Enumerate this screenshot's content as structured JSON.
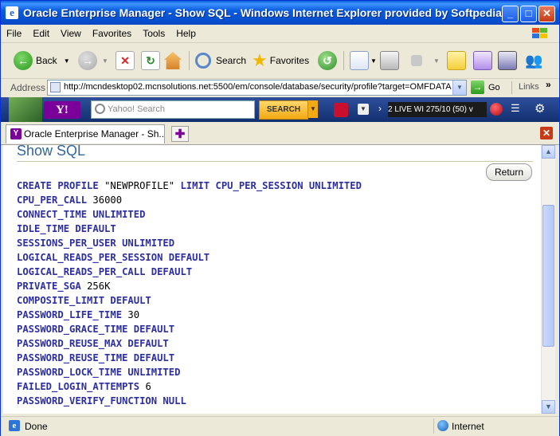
{
  "window": {
    "title": "Oracle Enterprise Manager - Show SQL - Windows Internet Explorer provided by Softpedia",
    "minimize": "_",
    "maximize": "□",
    "close": "✕"
  },
  "menu": [
    "File",
    "Edit",
    "View",
    "Favorites",
    "Tools",
    "Help"
  ],
  "toolbar": {
    "back_label": "Back",
    "search_label": "Search",
    "favorites_label": "Favorites"
  },
  "address": {
    "label": "Address",
    "url": "http://mcndesktop02.mcnsolutions.net:5500/em/console/database/security/profile?target=OMFDATA",
    "go_label": "Go",
    "links_label": "Links"
  },
  "yahoo": {
    "logo": "Y!",
    "search_placeholder": "Yahoo! Search",
    "search_button": "SEARCH",
    "ticker": "2 LIVE  WI 275/10 (50) v"
  },
  "tabs": [
    {
      "label": "Oracle Enterprise Manager - Sh..."
    }
  ],
  "page": {
    "title": "Show SQL",
    "return_label": "Return",
    "sql_lines": [
      {
        "kw": "CREATE PROFILE ",
        "val": "\"NEWPROFILE\"",
        "kw2": " LIMIT CPU_PER_SESSION UNLIMITED"
      },
      {
        "kw": "CPU_PER_CALL ",
        "val": "36000",
        "kw2": ""
      },
      {
        "kw": "CONNECT_TIME UNLIMITED",
        "val": "",
        "kw2": ""
      },
      {
        "kw": "IDLE_TIME DEFAULT",
        "val": "",
        "kw2": ""
      },
      {
        "kw": "SESSIONS_PER_USER UNLIMITED",
        "val": "",
        "kw2": ""
      },
      {
        "kw": "LOGICAL_READS_PER_SESSION DEFAULT",
        "val": "",
        "kw2": ""
      },
      {
        "kw": "LOGICAL_READS_PER_CALL DEFAULT",
        "val": "",
        "kw2": ""
      },
      {
        "kw": "PRIVATE_SGA ",
        "val": "256K",
        "kw2": ""
      },
      {
        "kw": "COMPOSITE_LIMIT DEFAULT",
        "val": "",
        "kw2": ""
      },
      {
        "kw": "PASSWORD_LIFE_TIME ",
        "val": "30",
        "kw2": ""
      },
      {
        "kw": "PASSWORD_GRACE_TIME DEFAULT",
        "val": "",
        "kw2": ""
      },
      {
        "kw": "PASSWORD_REUSE_MAX DEFAULT",
        "val": "",
        "kw2": ""
      },
      {
        "kw": "PASSWORD_REUSE_TIME DEFAULT",
        "val": "",
        "kw2": ""
      },
      {
        "kw": "PASSWORD_LOCK_TIME UNLIMITED",
        "val": "",
        "kw2": ""
      },
      {
        "kw": "FAILED_LOGIN_ATTEMPTS ",
        "val": "6",
        "kw2": ""
      },
      {
        "kw": "PASSWORD_VERIFY_FUNCTION NULL",
        "val": "",
        "kw2": ""
      }
    ]
  },
  "status": {
    "text": "Done",
    "zone": "Internet"
  },
  "colors": {
    "sql_keyword": "#2d2fa0",
    "title_blue": "#336699"
  }
}
